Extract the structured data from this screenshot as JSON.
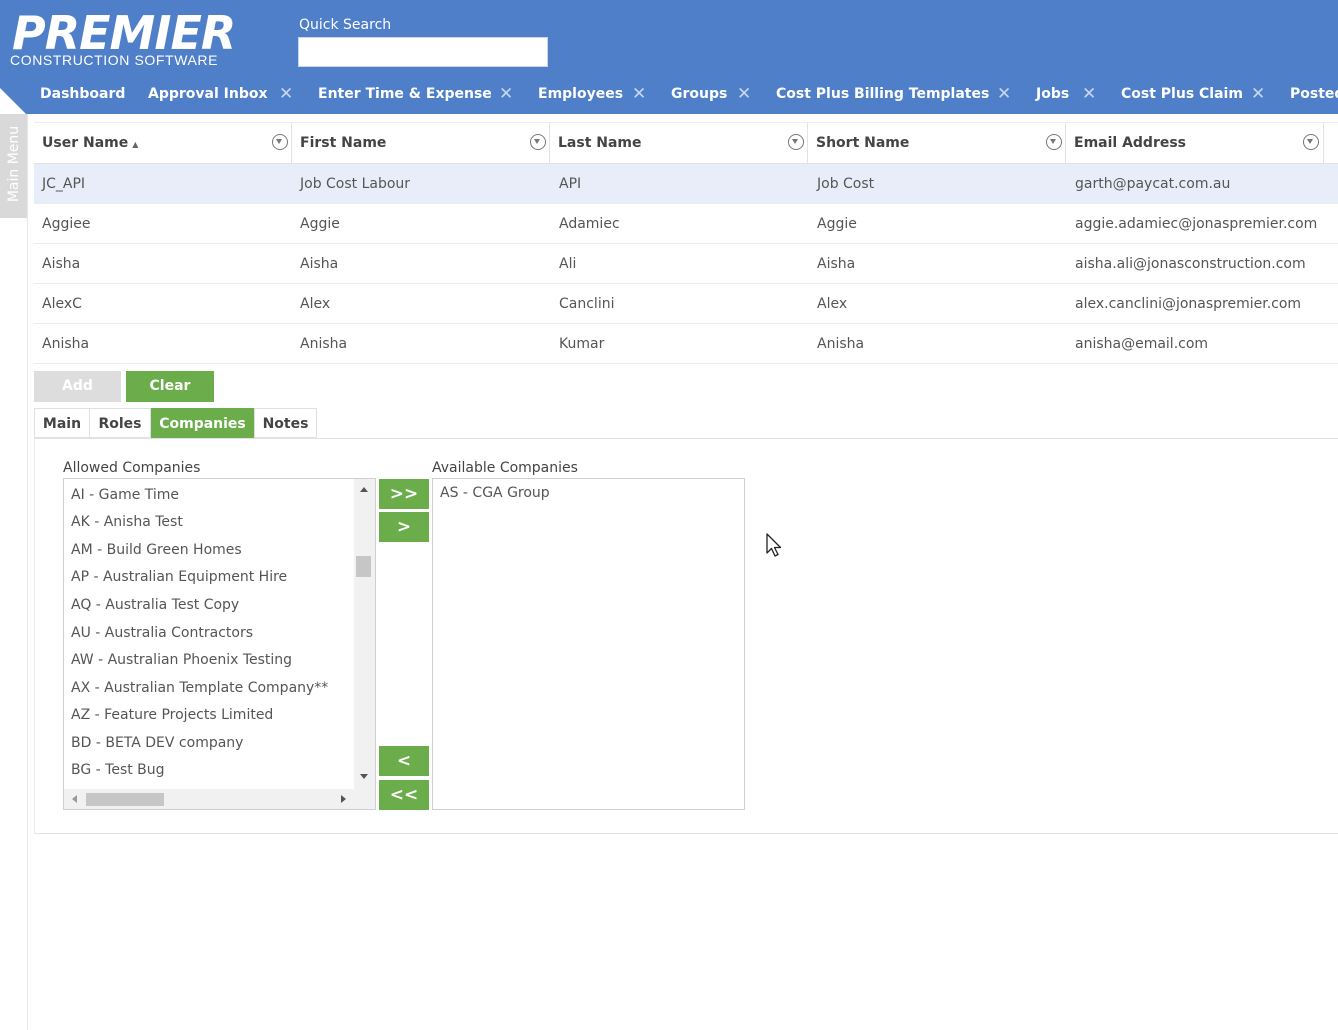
{
  "header": {
    "logo_main": "PREMIER",
    "logo_sub": "CONSTRUCTION SOFTWARE",
    "quick_search_label": "Quick Search",
    "quick_search_value": "",
    "tabs": [
      {
        "label": "Dashboard",
        "closable": false
      },
      {
        "label": "Approval Inbox",
        "closable": true
      },
      {
        "label": "Enter Time & Expense",
        "closable": true
      },
      {
        "label": "Employees",
        "closable": true
      },
      {
        "label": "Groups",
        "closable": true
      },
      {
        "label": "Cost Plus Billing Templates",
        "closable": true
      },
      {
        "label": "Jobs",
        "closable": true
      },
      {
        "label": "Cost Plus Claim",
        "closable": true
      },
      {
        "label": "Posted",
        "closable": false
      }
    ],
    "close_glyph": "✕"
  },
  "side_menu": {
    "label": "Main Menu"
  },
  "grid": {
    "columns": [
      "User Name",
      "First Name",
      "Last Name",
      "Short Name",
      "Email Address"
    ],
    "sort_indicator": "▲",
    "rows": [
      [
        "JC_API",
        "Job Cost Labour",
        "API",
        "Job Cost",
        "garth@paycat.com.au"
      ],
      [
        "Aggiee",
        "Aggie",
        "Adamiec",
        "Aggie",
        "aggie.adamiec@jonaspremier.com"
      ],
      [
        "Aisha",
        "Aisha",
        "Ali",
        "Aisha",
        "aisha.ali@jonasconstruction.com"
      ],
      [
        "AlexC",
        "Alex",
        "Canclini",
        "Alex",
        "alex.canclini@jonaspremier.com"
      ],
      [
        "Anisha",
        "Anisha",
        "Kumar",
        "Anisha",
        "anisha@email.com"
      ]
    ],
    "selected_row": 0
  },
  "actions": {
    "add_label": "Add",
    "clear_label": "Clear"
  },
  "subtabs": [
    {
      "label": "Main",
      "active": false
    },
    {
      "label": "Roles",
      "active": false
    },
    {
      "label": "Companies",
      "active": true
    },
    {
      "label": "Notes",
      "active": false
    }
  ],
  "companies": {
    "allowed_label": "Allowed Companies",
    "available_label": "Available Companies",
    "allowed": [
      "AI - Game Time",
      "AK - Anisha Test",
      "AM - Build Green Homes",
      "AP - Australian Equipment Hire",
      "AQ - Australia Test Copy",
      "AU - Australia Contractors",
      "AW - Australian Phoenix Testing",
      "AX - Australian Template Company**",
      "AZ - Feature Projects Limited",
      "BD - BETA DEV company",
      "BG - Test Bug"
    ],
    "available": [
      "AS - CGA Group"
    ],
    "buttons": {
      "add_all": ">>",
      "add_one": ">",
      "remove_one": "<",
      "remove_all": "<<"
    }
  },
  "colors": {
    "header": "#4f7fc8",
    "accent_green": "#6aad4a",
    "selected_row": "#e8eef9"
  }
}
